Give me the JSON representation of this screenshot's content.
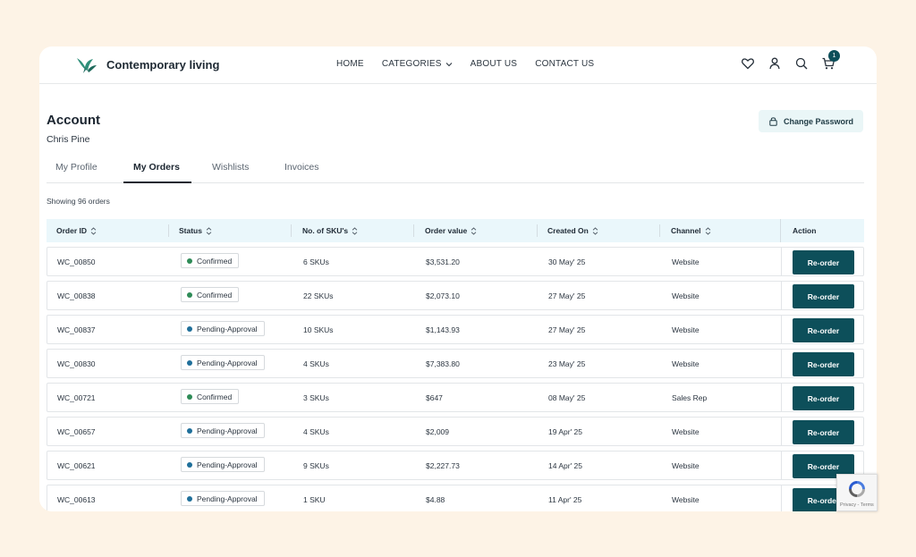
{
  "header": {
    "brand": "Contemporary living",
    "nav": [
      {
        "label": "HOME"
      },
      {
        "label": "CATEGORIES"
      },
      {
        "label": "ABOUT US"
      },
      {
        "label": "CONTACT US"
      }
    ],
    "icons": [
      "heart-icon",
      "user-icon",
      "search-icon",
      "cart-icon"
    ],
    "cart_count": "1"
  },
  "account": {
    "title": "Account",
    "name": "Chris Pine",
    "change_password": "Change Password"
  },
  "tabs": [
    {
      "label": "My Profile",
      "active": false
    },
    {
      "label": "My Orders",
      "active": true
    },
    {
      "label": "Wishlists",
      "active": false
    },
    {
      "label": "Invoices",
      "active": false
    }
  ],
  "summary": "Showing 96 orders",
  "table": {
    "columns": [
      "Order ID",
      "Status",
      "No. of SKU's",
      "Order value",
      "Created On",
      "Channel",
      "Action"
    ],
    "rows": [
      {
        "id": "WC_00850",
        "status": "Confirmed",
        "skus": "6 SKUs",
        "value": "$3,531.20",
        "created": "30 May' 25",
        "channel": "Website",
        "action": "Re-order"
      },
      {
        "id": "WC_00838",
        "status": "Confirmed",
        "skus": "22 SKUs",
        "value": "$2,073.10",
        "created": "27 May' 25",
        "channel": "Website",
        "action": "Re-order"
      },
      {
        "id": "WC_00837",
        "status": "Pending-Approval",
        "skus": "10 SKUs",
        "value": "$1,143.93",
        "created": "27 May' 25",
        "channel": "Website",
        "action": "Re-order"
      },
      {
        "id": "WC_00830",
        "status": "Pending-Approval",
        "skus": "4 SKUs",
        "value": "$7,383.80",
        "created": "23 May' 25",
        "channel": "Website",
        "action": "Re-order"
      },
      {
        "id": "WC_00721",
        "status": "Confirmed",
        "skus": "3 SKUs",
        "value": "$647",
        "created": "08 May' 25",
        "channel": "Sales Rep",
        "action": "Re-order"
      },
      {
        "id": "WC_00657",
        "status": "Pending-Approval",
        "skus": "4 SKUs",
        "value": "$2,009",
        "created": "19 Apr' 25",
        "channel": "Website",
        "action": "Re-order"
      },
      {
        "id": "WC_00621",
        "status": "Pending-Approval",
        "skus": "9 SKUs",
        "value": "$2,227.73",
        "created": "14 Apr' 25",
        "channel": "Website",
        "action": "Re-order"
      },
      {
        "id": "WC_00613",
        "status": "Pending-Approval",
        "skus": "1 SKU",
        "value": "$4.88",
        "created": "11 Apr' 25",
        "channel": "Website",
        "action": "Re-order"
      }
    ]
  },
  "status_colors": {
    "Confirmed": "#2e8b57",
    "Pending-Approval": "#1f6f9a"
  },
  "colors": {
    "accent": "#0d4f5a",
    "page_bg": "#fdf3e6",
    "table_header_bg": "#eaf7fb"
  },
  "captcha_text": "Privacy - Terms"
}
